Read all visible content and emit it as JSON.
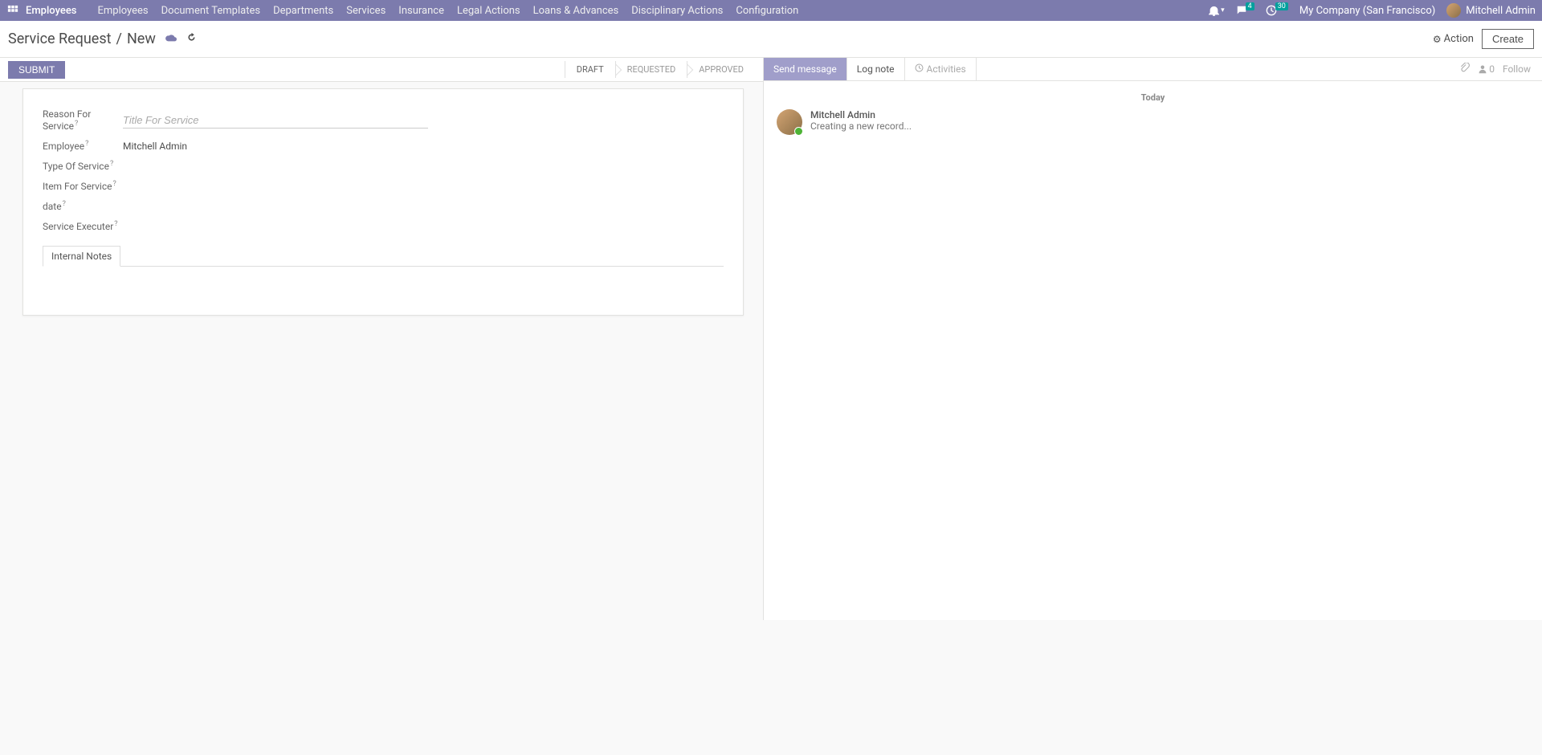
{
  "nav": {
    "app_name": "Employees",
    "items": [
      "Employees",
      "Document Templates",
      "Departments",
      "Services",
      "Insurance",
      "Legal Actions",
      "Loans & Advances",
      "Disciplinary Actions",
      "Configuration"
    ],
    "msg_badge": "4",
    "activity_badge": "30",
    "company": "My Company (San Francisco)",
    "user": "Mitchell Admin"
  },
  "breadcrumb": {
    "parent": "Service Request",
    "current": "New"
  },
  "actions": {
    "action_label": "Action",
    "create_label": "Create"
  },
  "statusbar": {
    "submit": "SUBMIT",
    "steps": [
      "DRAFT",
      "REQUESTED",
      "APPROVED"
    ]
  },
  "form": {
    "reason_label": "Reason For Service",
    "reason_placeholder": "Title For Service",
    "employee_label": "Employee",
    "employee_value": "Mitchell Admin",
    "type_label": "Type Of Service",
    "item_label": "Item For Service",
    "date_label": "date",
    "executer_label": "Service Executer",
    "tab_internal": "Internal Notes"
  },
  "chatter": {
    "send": "Send message",
    "log": "Log note",
    "activities": "Activities",
    "followers": "0",
    "follow": "Follow",
    "date": "Today",
    "msg_author": "Mitchell Admin",
    "msg_text": "Creating a new record..."
  }
}
